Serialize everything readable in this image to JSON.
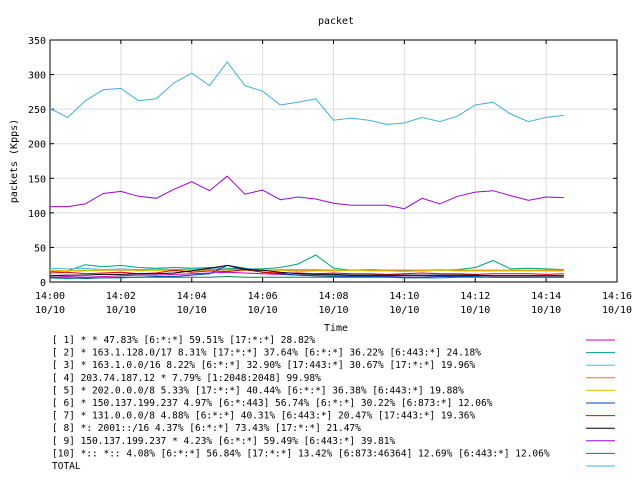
{
  "chart_data": {
    "type": "line",
    "title": "packet",
    "xlabel": "Time",
    "ylabel": "packets (Kpps)",
    "ylim": [
      0,
      350
    ],
    "yticks": [
      "0",
      "50",
      "100",
      "150",
      "200",
      "250",
      "300",
      "350"
    ],
    "xticks": [
      {
        "time": "14:00",
        "date": "10/10"
      },
      {
        "time": "14:02",
        "date": "10/10"
      },
      {
        "time": "14:04",
        "date": "10/10"
      },
      {
        "time": "14:06",
        "date": "10/10"
      },
      {
        "time": "14:08",
        "date": "10/10"
      },
      {
        "time": "14:10",
        "date": "10/10"
      },
      {
        "time": "14:12",
        "date": "10/10"
      },
      {
        "time": "14:14",
        "date": "10/10"
      },
      {
        "time": "14:16",
        "date": "10/10"
      }
    ],
    "x": [
      "14:00",
      "14:00:30",
      "14:01",
      "14:01:30",
      "14:02",
      "14:02:30",
      "14:03",
      "14:03:30",
      "14:04",
      "14:04:30",
      "14:05",
      "14:05:30",
      "14:06",
      "14:06:30",
      "14:07",
      "14:07:30",
      "14:08",
      "14:08:30",
      "14:09",
      "14:09:30",
      "14:10",
      "14:10:30",
      "14:11",
      "14:11:30",
      "14:12",
      "14:12:30",
      "14:13",
      "14:13:30",
      "14:14",
      "14:14:30"
    ],
    "series": [
      {
        "name": "[ 1] * * 47.83%  [6:*:*] 59.51% [17:*:*] 28.82%",
        "color": "#c000c0",
        "values": [
          9,
          8,
          7,
          8,
          9,
          10,
          10,
          11,
          12,
          13,
          14,
          13,
          12,
          11,
          10,
          9,
          9,
          9,
          9,
          9,
          9,
          9,
          9,
          9,
          9,
          9,
          9,
          9,
          9,
          9
        ]
      },
      {
        "name": "[ 2] * 163.1.128.0/17 8.31%  [17:*:*] 37.64% [6:*:*] 36.22% [6:443:*] 24.18%",
        "color": "#00a080",
        "values": [
          15,
          16,
          25,
          22,
          24,
          21,
          20,
          21,
          20,
          21,
          20,
          19,
          19,
          21,
          26,
          39,
          20,
          17,
          18,
          17,
          17,
          16,
          17,
          18,
          21,
          31,
          19,
          20,
          19,
          18
        ]
      },
      {
        "name": "[ 3] * 163.1.0.0/16 8.22%  [6:*:*] 32.90% [17:443:*] 30.67% [17:*:*] 19.96%",
        "color": "#40c0e0",
        "values": [
          20,
          19,
          20,
          18,
          19,
          18,
          19,
          18,
          19,
          19,
          18,
          18,
          17,
          18,
          18,
          18,
          17,
          17,
          18,
          17,
          17,
          17,
          18,
          17,
          17,
          17,
          17,
          17,
          17,
          17
        ]
      },
      {
        "name": "[ 4] 203.74.187.12 * 7.79%  [1:2048:2048] 99.98%",
        "color": "#e08000",
        "values": [
          17,
          16,
          17,
          17,
          17,
          17,
          17,
          17,
          17,
          18,
          18,
          17,
          17,
          17,
          17,
          17,
          17,
          17,
          17,
          17,
          17,
          17,
          17,
          17,
          17,
          17,
          17,
          17,
          17,
          17
        ]
      },
      {
        "name": "[ 5] * 202.0.0.0/8 5.33%  [17:*:*] 40.44% [6:*:*] 36.38% [6:443:*] 19.88%",
        "color": "#e0c000",
        "values": [
          17,
          16,
          16,
          17,
          18,
          16,
          17,
          16,
          17,
          16,
          16,
          17,
          16,
          17,
          15,
          16,
          16,
          17,
          16,
          16,
          15,
          16,
          17,
          16,
          16,
          16,
          16,
          16,
          16,
          16
        ]
      },
      {
        "name": "[ 6] * 150.137.199.237 4.97%  [6:*:443] 56.74% [6:*:*] 30.22% [6:873:*] 12.06%",
        "color": "#0040c0",
        "values": [
          7,
          6,
          5,
          6,
          7,
          7,
          8,
          8,
          10,
          12,
          24,
          20,
          14,
          12,
          10,
          9,
          8,
          8,
          8,
          8,
          7,
          7,
          8,
          8,
          8,
          7,
          7,
          7,
          7,
          7
        ]
      },
      {
        "name": "[ 7] * 131.0.0.0/8 4.88%  [6:*:*] 40.31% [6:443:*] 20.47% [17:443:*] 19.36%",
        "color": "#e00000",
        "values": [
          13,
          14,
          12,
          13,
          14,
          12,
          13,
          17,
          14,
          16,
          15,
          18,
          14,
          13,
          13,
          12,
          13,
          12,
          12,
          11,
          12,
          13,
          12,
          12,
          11,
          12,
          12,
          12,
          11,
          12
        ]
      },
      {
        "name": "[ 8] *: 2001::/16 4.37%  [6:*:*] 73.43% [17:*:*] 21.47%",
        "color": "#000000",
        "values": [
          9,
          10,
          10,
          11,
          11,
          12,
          12,
          13,
          16,
          20,
          24,
          18,
          17,
          14,
          12,
          11,
          11,
          10,
          10,
          10,
          10,
          10,
          10,
          10,
          10,
          9,
          9,
          9,
          9,
          9
        ]
      },
      {
        "name": "[ 9] 150.137.199.237 * 4.23%  [6:*:*] 59.49% [6:443:*] 39.81%",
        "color": "#a000e0",
        "values": [
          109,
          109,
          113,
          128,
          131,
          124,
          121,
          134,
          145,
          132,
          153,
          127,
          133,
          119,
          123,
          120,
          114,
          111,
          111,
          111,
          106,
          121,
          113,
          124,
          130,
          132,
          125,
          118,
          123,
          122
        ]
      },
      {
        "name": "[10] *:: *:: 4.08%  [6:*:*] 56.84% [17:*:*] 13.42% [6:873:46364] 12.69% [6:443:*] 12.06%",
        "color": "#008060",
        "values": [
          6,
          5,
          6,
          6,
          6,
          7,
          7,
          7,
          7,
          7,
          8,
          7,
          7,
          7,
          7,
          7,
          7,
          7,
          7,
          7,
          6,
          6,
          6,
          7,
          7,
          7,
          7,
          7,
          7,
          7
        ]
      },
      {
        "name": "TOTAL",
        "color": "#40b0e0",
        "values": [
          251,
          238,
          262,
          278,
          280,
          262,
          265,
          288,
          302,
          284,
          318,
          284,
          276,
          256,
          260,
          265,
          234,
          237,
          234,
          228,
          230,
          238,
          232,
          240,
          256,
          260,
          243,
          232,
          238,
          241
        ]
      }
    ]
  }
}
